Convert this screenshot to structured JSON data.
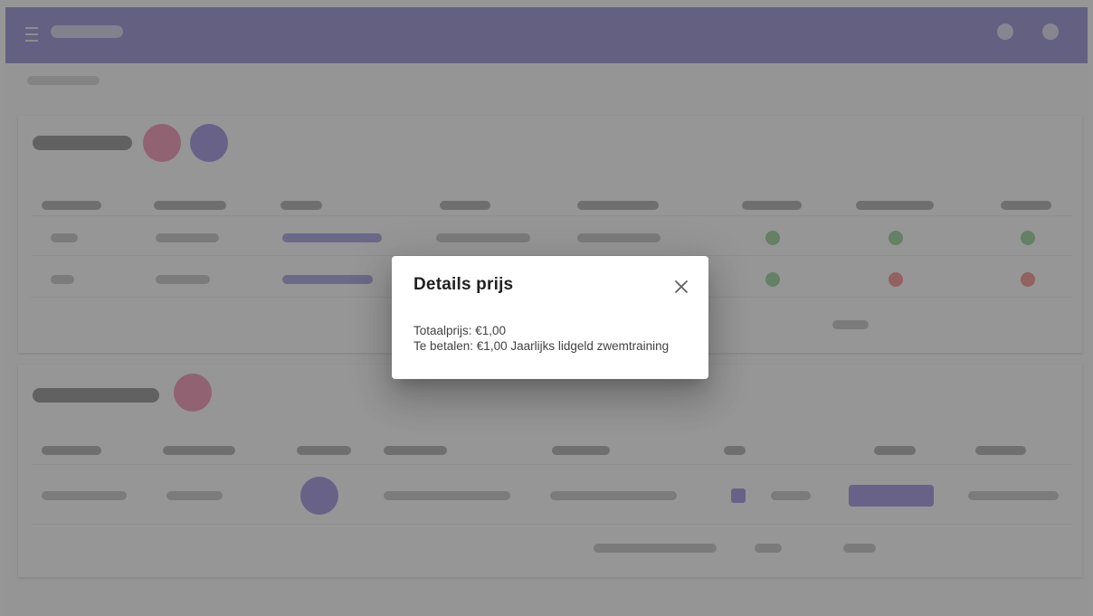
{
  "dialog": {
    "title": "Details prijs",
    "close_icon": "close-icon",
    "total_line": "Totaalprijs: €1,00",
    "pay_line": "Te betalen: €1,00 Jaarlijks lidgeld zwemtraining"
  },
  "colors": {
    "appbar": "#4e3fb5",
    "accent_pink": "#e8467e",
    "accent_purple": "#5b46d1",
    "status_green": "#4caf50",
    "status_red": "#f44336"
  }
}
